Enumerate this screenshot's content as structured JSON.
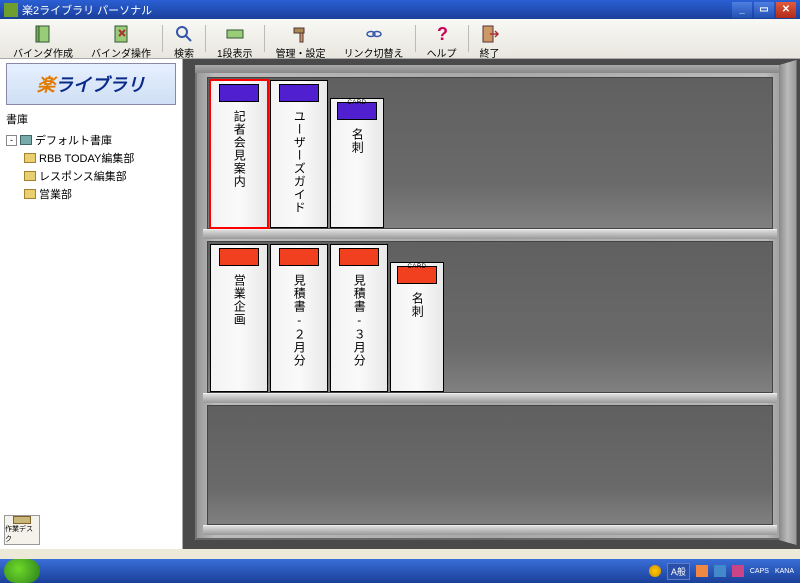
{
  "window": {
    "title": "楽2ライブラリ パーソナル"
  },
  "toolbar": {
    "create": "バインダ作成",
    "operate": "バインダ操作",
    "search": "検索",
    "view": "1段表示",
    "settings": "管理・設定",
    "linkswitch": "リンク切替え",
    "help": "ヘルプ",
    "exit": "終了"
  },
  "logo": {
    "prefix": "楽",
    "text": "ライブラリ"
  },
  "tree": {
    "header": "書庫",
    "root": "デフォルト書庫",
    "items": [
      {
        "label": "RBB TODAY編集部"
      },
      {
        "label": "レスポンス編集部"
      },
      {
        "label": "営業部"
      }
    ]
  },
  "deskbtn": "作業デスク",
  "shelves": {
    "row1": [
      {
        "title": "記者会見案内",
        "color": "purple",
        "selected": true,
        "card": false
      },
      {
        "title": "ユーザーズガイド",
        "color": "purple",
        "selected": false,
        "card": false
      },
      {
        "title": "名刺",
        "color": "purple",
        "selected": false,
        "card": true,
        "cardlabel": "CARD"
      }
    ],
    "row2": [
      {
        "title": "営業企画",
        "color": "red",
        "selected": false,
        "card": false
      },
      {
        "title": "見積書‐２月分",
        "color": "red",
        "selected": false,
        "card": false
      },
      {
        "title": "見積書‐３月分",
        "color": "red",
        "selected": false,
        "card": false
      },
      {
        "title": "名刺",
        "color": "red",
        "selected": false,
        "card": true,
        "cardlabel": "CARD"
      }
    ]
  },
  "tray": {
    "lang": "A般",
    "caps": "CAPS",
    "kana": "KANA"
  }
}
